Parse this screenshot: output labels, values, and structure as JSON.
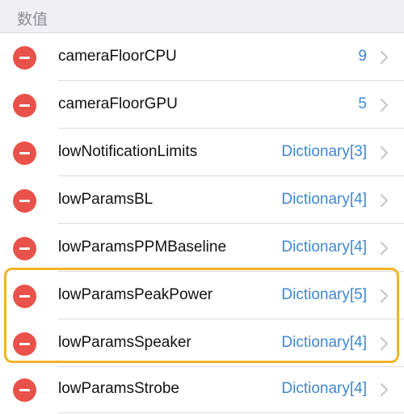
{
  "section": {
    "title": "数值"
  },
  "rows": [
    {
      "key": "cameraFloorCPU",
      "value": "9"
    },
    {
      "key": "cameraFloorGPU",
      "value": "5"
    },
    {
      "key": "lowNotificationLimits",
      "value": "Dictionary[3]"
    },
    {
      "key": "lowParamsBL",
      "value": "Dictionary[4]"
    },
    {
      "key": "lowParamsPPMBaseline",
      "value": "Dictionary[4]"
    },
    {
      "key": "lowParamsPeakPower",
      "value": "Dictionary[5]"
    },
    {
      "key": "lowParamsSpeaker",
      "value": "Dictionary[4]"
    },
    {
      "key": "lowParamsStrobe",
      "value": "Dictionary[4]"
    }
  ],
  "colors": {
    "delete": "#e9524a",
    "value": "#3f87d1",
    "highlight": "#f0b429",
    "chevron": "#c7c7cc"
  },
  "icons": {
    "delete": "minus-circle-icon",
    "disclosure": "chevron-right-icon"
  }
}
